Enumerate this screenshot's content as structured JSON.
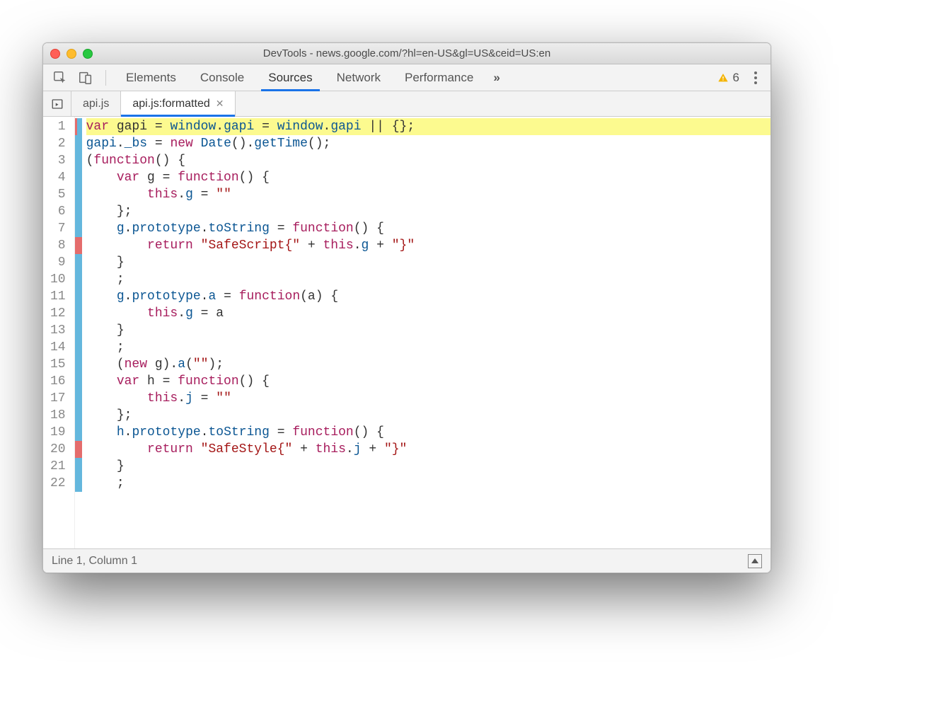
{
  "window": {
    "title": "DevTools - news.google.com/?hl=en-US&gl=US&ceid=US:en"
  },
  "toolbar": {
    "tabs": [
      "Elements",
      "Console",
      "Sources",
      "Network",
      "Performance"
    ],
    "active": "Sources",
    "more": "»",
    "warning_count": "6"
  },
  "filetabs": {
    "items": [
      {
        "label": "api.js",
        "closable": false
      },
      {
        "label": "api.js:formatted",
        "closable": true
      }
    ],
    "active_index": 1
  },
  "code": {
    "lines": [
      {
        "n": 1,
        "mark": "blue-left",
        "hl": true,
        "tokens": [
          [
            "kw",
            "var"
          ],
          [
            "op",
            " gapi "
          ],
          [
            "op",
            "= "
          ],
          [
            "prop",
            "window"
          ],
          [
            "op",
            "."
          ],
          [
            "prop",
            "gapi"
          ],
          [
            "op",
            " = "
          ],
          [
            "prop",
            "window"
          ],
          [
            "op",
            "."
          ],
          [
            "prop",
            "gapi"
          ],
          [
            "op",
            " || {};"
          ]
        ]
      },
      {
        "n": 2,
        "mark": "blue",
        "tokens": [
          [
            "prop",
            "gapi"
          ],
          [
            "op",
            "."
          ],
          [
            "prop",
            "_bs"
          ],
          [
            "op",
            " = "
          ],
          [
            "kw",
            "new"
          ],
          [
            "op",
            " "
          ],
          [
            "fn",
            "Date"
          ],
          [
            "op",
            "()."
          ],
          [
            "fn",
            "getTime"
          ],
          [
            "op",
            "();"
          ]
        ]
      },
      {
        "n": 3,
        "mark": "blue",
        "tokens": [
          [
            "op",
            "("
          ],
          [
            "kw",
            "function"
          ],
          [
            "op",
            "() {"
          ]
        ]
      },
      {
        "n": 4,
        "mark": "blue",
        "tokens": [
          [
            "op",
            "    "
          ],
          [
            "kw",
            "var"
          ],
          [
            "op",
            " g = "
          ],
          [
            "kw",
            "function"
          ],
          [
            "op",
            "() {"
          ]
        ]
      },
      {
        "n": 5,
        "mark": "blue",
        "tokens": [
          [
            "op",
            "        "
          ],
          [
            "kw",
            "this"
          ],
          [
            "op",
            "."
          ],
          [
            "prop",
            "g"
          ],
          [
            "op",
            " = "
          ],
          [
            "str",
            "\"\""
          ]
        ]
      },
      {
        "n": 6,
        "mark": "blue",
        "tokens": [
          [
            "op",
            "    };"
          ]
        ]
      },
      {
        "n": 7,
        "mark": "blue",
        "tokens": [
          [
            "op",
            "    "
          ],
          [
            "prop",
            "g"
          ],
          [
            "op",
            "."
          ],
          [
            "prop",
            "prototype"
          ],
          [
            "op",
            "."
          ],
          [
            "prop",
            "toString"
          ],
          [
            "op",
            " = "
          ],
          [
            "kw",
            "function"
          ],
          [
            "op",
            "() {"
          ]
        ]
      },
      {
        "n": 8,
        "mark": "red",
        "tokens": [
          [
            "op",
            "        "
          ],
          [
            "kw",
            "return"
          ],
          [
            "op",
            " "
          ],
          [
            "str",
            "\"SafeScript{\""
          ],
          [
            "op",
            " + "
          ],
          [
            "kw",
            "this"
          ],
          [
            "op",
            "."
          ],
          [
            "prop",
            "g"
          ],
          [
            "op",
            " + "
          ],
          [
            "str",
            "\"}\""
          ]
        ]
      },
      {
        "n": 9,
        "mark": "blue",
        "tokens": [
          [
            "op",
            "    }"
          ]
        ]
      },
      {
        "n": 10,
        "mark": "blue",
        "tokens": [
          [
            "op",
            "    ;"
          ]
        ]
      },
      {
        "n": 11,
        "mark": "blue",
        "tokens": [
          [
            "op",
            "    "
          ],
          [
            "prop",
            "g"
          ],
          [
            "op",
            "."
          ],
          [
            "prop",
            "prototype"
          ],
          [
            "op",
            "."
          ],
          [
            "prop",
            "a"
          ],
          [
            "op",
            " = "
          ],
          [
            "kw",
            "function"
          ],
          [
            "op",
            "(a) {"
          ]
        ]
      },
      {
        "n": 12,
        "mark": "blue",
        "tokens": [
          [
            "op",
            "        "
          ],
          [
            "kw",
            "this"
          ],
          [
            "op",
            "."
          ],
          [
            "prop",
            "g"
          ],
          [
            "op",
            " = a"
          ]
        ]
      },
      {
        "n": 13,
        "mark": "blue",
        "tokens": [
          [
            "op",
            "    }"
          ]
        ]
      },
      {
        "n": 14,
        "mark": "blue",
        "tokens": [
          [
            "op",
            "    ;"
          ]
        ]
      },
      {
        "n": 15,
        "mark": "blue",
        "tokens": [
          [
            "op",
            "    ("
          ],
          [
            "kw",
            "new"
          ],
          [
            "op",
            " g)."
          ],
          [
            "fn",
            "a"
          ],
          [
            "op",
            "("
          ],
          [
            "str",
            "\"\""
          ],
          [
            "op",
            ");"
          ]
        ]
      },
      {
        "n": 16,
        "mark": "blue",
        "tokens": [
          [
            "op",
            "    "
          ],
          [
            "kw",
            "var"
          ],
          [
            "op",
            " h = "
          ],
          [
            "kw",
            "function"
          ],
          [
            "op",
            "() {"
          ]
        ]
      },
      {
        "n": 17,
        "mark": "blue",
        "tokens": [
          [
            "op",
            "        "
          ],
          [
            "kw",
            "this"
          ],
          [
            "op",
            "."
          ],
          [
            "prop",
            "j"
          ],
          [
            "op",
            " = "
          ],
          [
            "str",
            "\"\""
          ]
        ]
      },
      {
        "n": 18,
        "mark": "blue",
        "tokens": [
          [
            "op",
            "    };"
          ]
        ]
      },
      {
        "n": 19,
        "mark": "blue",
        "tokens": [
          [
            "op",
            "    "
          ],
          [
            "prop",
            "h"
          ],
          [
            "op",
            "."
          ],
          [
            "prop",
            "prototype"
          ],
          [
            "op",
            "."
          ],
          [
            "prop",
            "toString"
          ],
          [
            "op",
            " = "
          ],
          [
            "kw",
            "function"
          ],
          [
            "op",
            "() {"
          ]
        ]
      },
      {
        "n": 20,
        "mark": "red",
        "tokens": [
          [
            "op",
            "        "
          ],
          [
            "kw",
            "return"
          ],
          [
            "op",
            " "
          ],
          [
            "str",
            "\"SafeStyle{\""
          ],
          [
            "op",
            " + "
          ],
          [
            "kw",
            "this"
          ],
          [
            "op",
            "."
          ],
          [
            "prop",
            "j"
          ],
          [
            "op",
            " + "
          ],
          [
            "str",
            "\"}\""
          ]
        ]
      },
      {
        "n": 21,
        "mark": "blue",
        "tokens": [
          [
            "op",
            "    }"
          ]
        ]
      },
      {
        "n": 22,
        "mark": "blue",
        "tokens": [
          [
            "op",
            "    ;"
          ]
        ]
      }
    ]
  },
  "status": {
    "position": "Line 1, Column 1"
  }
}
